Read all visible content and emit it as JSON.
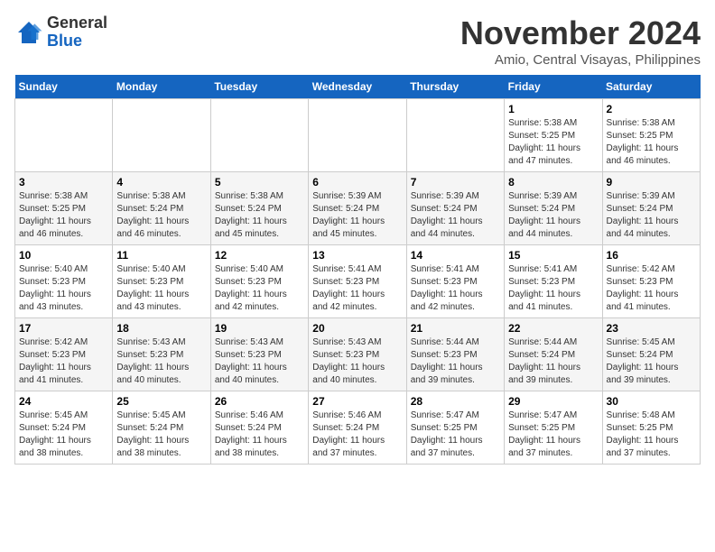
{
  "logo": {
    "line1": "General",
    "line2": "Blue"
  },
  "title": "November 2024",
  "location": "Amio, Central Visayas, Philippines",
  "days_of_week": [
    "Sunday",
    "Monday",
    "Tuesday",
    "Wednesday",
    "Thursday",
    "Friday",
    "Saturday"
  ],
  "weeks": [
    [
      {
        "day": "",
        "info": ""
      },
      {
        "day": "",
        "info": ""
      },
      {
        "day": "",
        "info": ""
      },
      {
        "day": "",
        "info": ""
      },
      {
        "day": "",
        "info": ""
      },
      {
        "day": "1",
        "info": "Sunrise: 5:38 AM\nSunset: 5:25 PM\nDaylight: 11 hours\nand 47 minutes."
      },
      {
        "day": "2",
        "info": "Sunrise: 5:38 AM\nSunset: 5:25 PM\nDaylight: 11 hours\nand 46 minutes."
      }
    ],
    [
      {
        "day": "3",
        "info": "Sunrise: 5:38 AM\nSunset: 5:25 PM\nDaylight: 11 hours\nand 46 minutes."
      },
      {
        "day": "4",
        "info": "Sunrise: 5:38 AM\nSunset: 5:24 PM\nDaylight: 11 hours\nand 46 minutes."
      },
      {
        "day": "5",
        "info": "Sunrise: 5:38 AM\nSunset: 5:24 PM\nDaylight: 11 hours\nand 45 minutes."
      },
      {
        "day": "6",
        "info": "Sunrise: 5:39 AM\nSunset: 5:24 PM\nDaylight: 11 hours\nand 45 minutes."
      },
      {
        "day": "7",
        "info": "Sunrise: 5:39 AM\nSunset: 5:24 PM\nDaylight: 11 hours\nand 44 minutes."
      },
      {
        "day": "8",
        "info": "Sunrise: 5:39 AM\nSunset: 5:24 PM\nDaylight: 11 hours\nand 44 minutes."
      },
      {
        "day": "9",
        "info": "Sunrise: 5:39 AM\nSunset: 5:24 PM\nDaylight: 11 hours\nand 44 minutes."
      }
    ],
    [
      {
        "day": "10",
        "info": "Sunrise: 5:40 AM\nSunset: 5:23 PM\nDaylight: 11 hours\nand 43 minutes."
      },
      {
        "day": "11",
        "info": "Sunrise: 5:40 AM\nSunset: 5:23 PM\nDaylight: 11 hours\nand 43 minutes."
      },
      {
        "day": "12",
        "info": "Sunrise: 5:40 AM\nSunset: 5:23 PM\nDaylight: 11 hours\nand 42 minutes."
      },
      {
        "day": "13",
        "info": "Sunrise: 5:41 AM\nSunset: 5:23 PM\nDaylight: 11 hours\nand 42 minutes."
      },
      {
        "day": "14",
        "info": "Sunrise: 5:41 AM\nSunset: 5:23 PM\nDaylight: 11 hours\nand 42 minutes."
      },
      {
        "day": "15",
        "info": "Sunrise: 5:41 AM\nSunset: 5:23 PM\nDaylight: 11 hours\nand 41 minutes."
      },
      {
        "day": "16",
        "info": "Sunrise: 5:42 AM\nSunset: 5:23 PM\nDaylight: 11 hours\nand 41 minutes."
      }
    ],
    [
      {
        "day": "17",
        "info": "Sunrise: 5:42 AM\nSunset: 5:23 PM\nDaylight: 11 hours\nand 41 minutes."
      },
      {
        "day": "18",
        "info": "Sunrise: 5:43 AM\nSunset: 5:23 PM\nDaylight: 11 hours\nand 40 minutes."
      },
      {
        "day": "19",
        "info": "Sunrise: 5:43 AM\nSunset: 5:23 PM\nDaylight: 11 hours\nand 40 minutes."
      },
      {
        "day": "20",
        "info": "Sunrise: 5:43 AM\nSunset: 5:23 PM\nDaylight: 11 hours\nand 40 minutes."
      },
      {
        "day": "21",
        "info": "Sunrise: 5:44 AM\nSunset: 5:23 PM\nDaylight: 11 hours\nand 39 minutes."
      },
      {
        "day": "22",
        "info": "Sunrise: 5:44 AM\nSunset: 5:24 PM\nDaylight: 11 hours\nand 39 minutes."
      },
      {
        "day": "23",
        "info": "Sunrise: 5:45 AM\nSunset: 5:24 PM\nDaylight: 11 hours\nand 39 minutes."
      }
    ],
    [
      {
        "day": "24",
        "info": "Sunrise: 5:45 AM\nSunset: 5:24 PM\nDaylight: 11 hours\nand 38 minutes."
      },
      {
        "day": "25",
        "info": "Sunrise: 5:45 AM\nSunset: 5:24 PM\nDaylight: 11 hours\nand 38 minutes."
      },
      {
        "day": "26",
        "info": "Sunrise: 5:46 AM\nSunset: 5:24 PM\nDaylight: 11 hours\nand 38 minutes."
      },
      {
        "day": "27",
        "info": "Sunrise: 5:46 AM\nSunset: 5:24 PM\nDaylight: 11 hours\nand 37 minutes."
      },
      {
        "day": "28",
        "info": "Sunrise: 5:47 AM\nSunset: 5:25 PM\nDaylight: 11 hours\nand 37 minutes."
      },
      {
        "day": "29",
        "info": "Sunrise: 5:47 AM\nSunset: 5:25 PM\nDaylight: 11 hours\nand 37 minutes."
      },
      {
        "day": "30",
        "info": "Sunrise: 5:48 AM\nSunset: 5:25 PM\nDaylight: 11 hours\nand 37 minutes."
      }
    ]
  ]
}
